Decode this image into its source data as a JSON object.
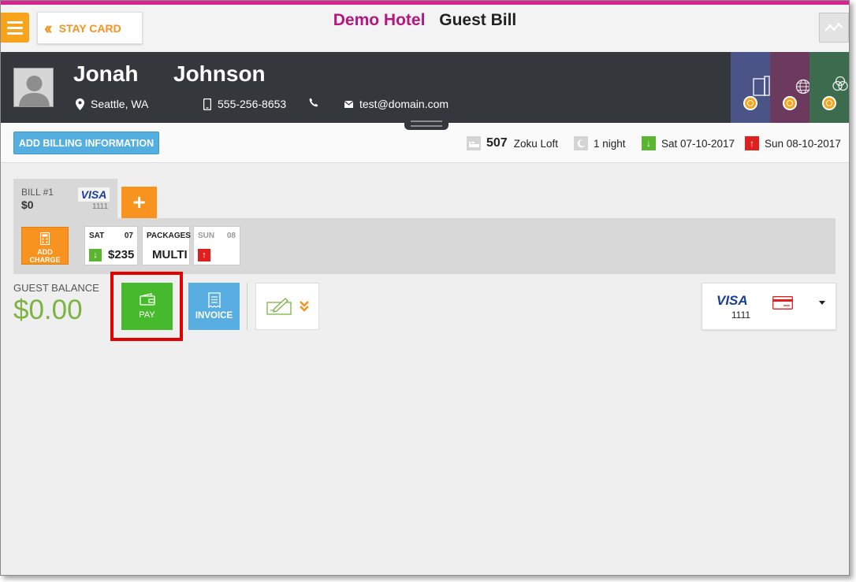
{
  "header": {
    "back_label": "STAY CARD",
    "hotel_name": "Demo Hotel",
    "page_title": "Guest Bill"
  },
  "guest": {
    "first_name": "Jonah",
    "last_name": "Johnson",
    "location": "Seattle, WA",
    "phone": "555-256-8653",
    "email": "test@domain.com"
  },
  "loyalty_cards": [
    {
      "color": "#4a5486",
      "icon": "building-icon"
    },
    {
      "color": "#6b3a5e",
      "icon": "globe-icon"
    },
    {
      "color": "#3d6b4d",
      "icon": "circles-icon"
    }
  ],
  "infobar": {
    "billing_button": "ADD BILLING INFORMATION",
    "room_number": "507",
    "room_type": "Zoku Loft",
    "nights": "1 night",
    "arrival": "Sat 07-10-2017",
    "departure": "Sun 08-10-2017"
  },
  "bill": {
    "name": "BILL #1",
    "amount": "$0",
    "card_brand": "VISA",
    "card_digits": "1111",
    "add_bill_symbol": "+"
  },
  "charges": {
    "add_charge_label": "ADD CHARGE",
    "days": [
      {
        "day": "SAT",
        "date": "07",
        "value": "$235",
        "marker": "arrival"
      },
      {
        "day": "PACKAGES",
        "date": "",
        "value": "MULTI",
        "marker": "none"
      },
      {
        "day": "SUN",
        "date": "08",
        "value": "",
        "marker": "departure"
      }
    ]
  },
  "balance": {
    "label": "GUEST BALANCE",
    "amount": "$0.00"
  },
  "actions": {
    "pay_label": "PAY",
    "invoice_label": "INVOICE"
  },
  "payment_card": {
    "brand": "VISA",
    "digits": "1111"
  },
  "colors": {
    "accent_pink": "#d8248f",
    "hotel_name": "#b8157e",
    "orange": "#f7931e",
    "pay_green": "#46b92d",
    "invoice_blue": "#58aee0",
    "balance_green": "#7cb342",
    "highlight_red": "#e50000",
    "arrival_green": "#5cb531",
    "departure_red": "#e0201f"
  }
}
